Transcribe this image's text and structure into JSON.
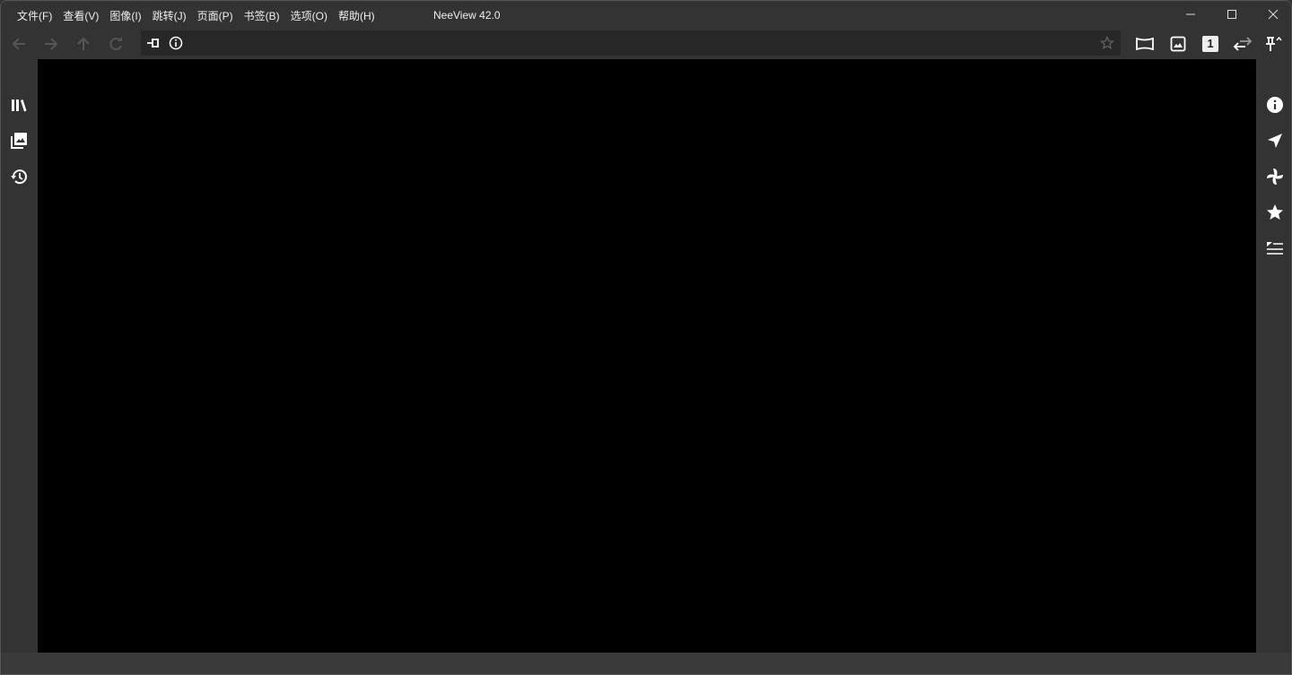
{
  "menu": [
    "文件(F)",
    "查看(V)",
    "图像(I)",
    "跳转(J)",
    "页面(P)",
    "书签(B)",
    "选项(O)",
    "帮助(H)"
  ],
  "title": "NeeView 42.0",
  "toolbar": {
    "page_badge": "1"
  },
  "colors": {
    "background": "#333333",
    "viewer": "#000000",
    "address": "#282828"
  }
}
